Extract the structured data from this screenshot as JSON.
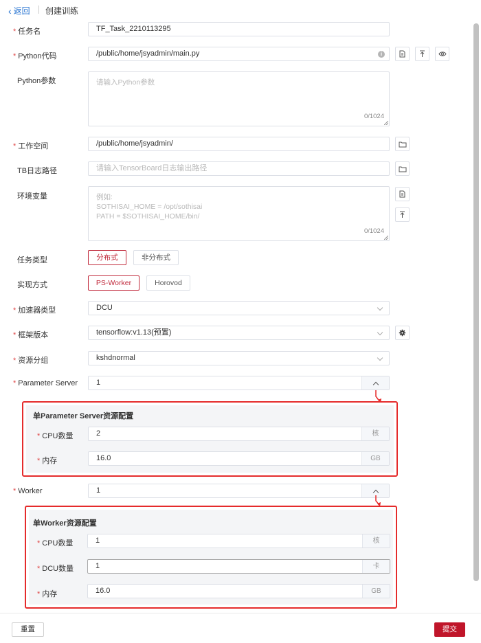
{
  "header": {
    "back_label": "返回",
    "title": "创建训练"
  },
  "form": {
    "task_name": {
      "label": "任务名",
      "value": "TF_Task_2210113295"
    },
    "python_code": {
      "label": "Python代码",
      "value": "/public/home/jsyadmin/main.py"
    },
    "python_params": {
      "label": "Python参数",
      "placeholder": "请输入Python参数",
      "counter": "0/1024"
    },
    "workspace": {
      "label": "工作空间",
      "value": "/public/home/jsyadmin/"
    },
    "tb_log": {
      "label": "TB日志路径",
      "placeholder": "请输入TensorBoard日志输出路径"
    },
    "env": {
      "label": "环境变量",
      "placeholder_lines": [
        "例如:",
        "SOTHISAI_HOME = /opt/sothisai",
        "PATH = $SOTHISAI_HOME/bin/"
      ],
      "counter": "0/1024"
    },
    "task_type": {
      "label": "任务类型",
      "options": [
        "分布式",
        "非分布式"
      ],
      "selected": "分布式"
    },
    "impl": {
      "label": "实现方式",
      "options": [
        "PS-Worker",
        "Horovod"
      ],
      "selected": "PS-Worker"
    },
    "accelerator": {
      "label": "加速器类型",
      "value": "DCU"
    },
    "framework": {
      "label": "框架版本",
      "value": "tensorflow:v1.13(预置)"
    },
    "resource_group": {
      "label": "资源分组",
      "value": "kshdnormal"
    },
    "parameter_server": {
      "label": "Parameter Server",
      "value": "1"
    },
    "ps_config": {
      "title": "单Parameter Server资源配置",
      "cpu": {
        "label": "CPU数量",
        "value": "2",
        "unit": "核"
      },
      "memory": {
        "label": "内存",
        "value": "16.0",
        "unit": "GB"
      }
    },
    "worker": {
      "label": "Worker",
      "value": "1"
    },
    "worker_config": {
      "title": "单Worker资源配置",
      "cpu": {
        "label": "CPU数量",
        "value": "1",
        "unit": "核"
      },
      "dcu": {
        "label": "DCU数量",
        "value": "1",
        "unit": "卡"
      },
      "memory": {
        "label": "内存",
        "value": "16.0",
        "unit": "GB"
      }
    }
  },
  "footer": {
    "reset_label": "重置",
    "submit_label": "提交"
  },
  "colors": {
    "primary": "#c0152a",
    "annotation": "#e52b2b",
    "link": "#1f6fd0"
  },
  "icons": [
    "chevron-left-icon",
    "info-icon",
    "file-icon",
    "upload-icon",
    "eye-icon",
    "folder-icon",
    "gear-icon",
    "chevron-down-icon",
    "chevron-up-icon"
  ]
}
